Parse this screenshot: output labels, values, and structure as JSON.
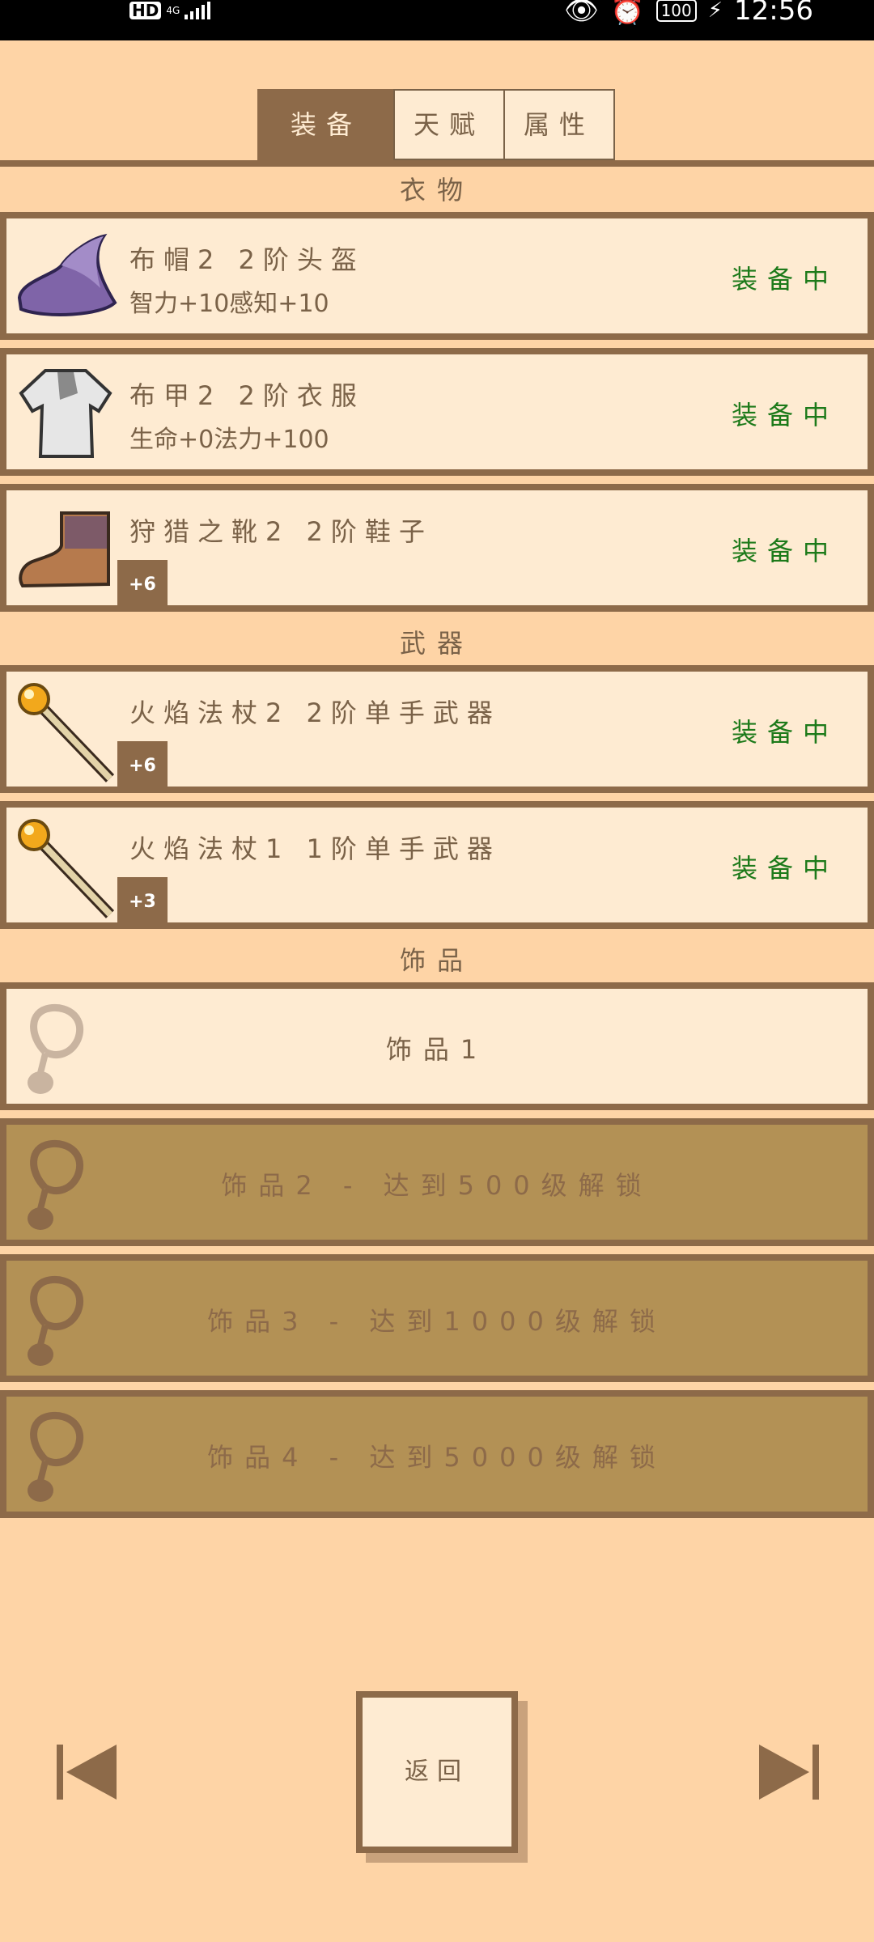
{
  "status_bar": {
    "hd": "HD",
    "network": "4G",
    "battery": "100",
    "time": "12:56"
  },
  "tabs": [
    {
      "label": "装备"
    },
    {
      "label": "天赋"
    },
    {
      "label": "属性"
    }
  ],
  "sections": {
    "clothing": "衣物",
    "weapons": "武器",
    "accessories": "饰品"
  },
  "items": [
    {
      "title": "布帽2  2阶头盔",
      "stats": "智力+10感知+10",
      "status": "装备中",
      "icon": "wizard-hat-icon"
    },
    {
      "title": "布甲2  2阶衣服",
      "stats": "生命+0法力+100",
      "status": "装备中",
      "icon": "cloth-armor-icon"
    },
    {
      "title": "狩猎之靴2  2阶鞋子",
      "badge": "+6",
      "status": "装备中",
      "icon": "boots-icon"
    },
    {
      "title": "火焰法杖2  2阶单手武器",
      "badge": "+6",
      "status": "装备中",
      "icon": "fire-staff-icon"
    },
    {
      "title": "火焰法杖1  1阶单手武器",
      "badge": "+3",
      "status": "装备中",
      "icon": "fire-staff-icon"
    }
  ],
  "accessory_slots": [
    {
      "label": "饰品1"
    },
    {
      "label": "饰品2 - 达到500级解锁"
    },
    {
      "label": "饰品3 - 达到1000级解锁"
    },
    {
      "label": "饰品4 - 达到5000级解锁"
    }
  ],
  "footer": {
    "back_label": "返回"
  },
  "colors": {
    "background": "#fed4a6",
    "panel": "#feebd2",
    "border": "#8d6a49",
    "equipped": "#1d7a1a",
    "locked": "#b39155"
  }
}
